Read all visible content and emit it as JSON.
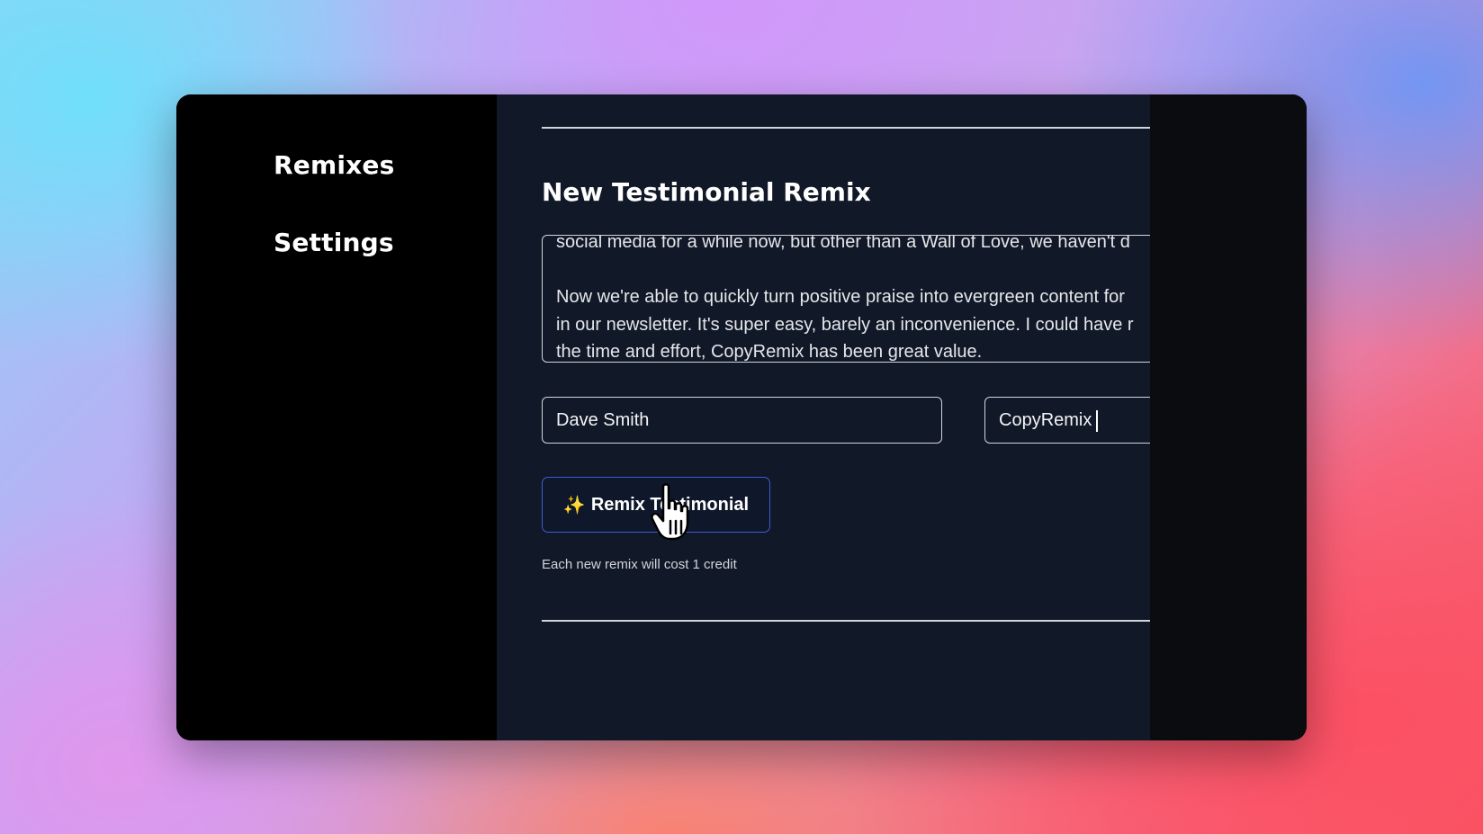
{
  "sidebar": {
    "items": [
      {
        "label": "Remixes"
      },
      {
        "label": "Settings"
      }
    ]
  },
  "form": {
    "title": "New Testimonial Remix",
    "testimonial_text": "social media for a while now, but other than a Wall of Love, we haven't d\n\nNow we're able to quickly turn positive praise into evergreen content for\nin our newsletter. It's super easy, barely an inconvenience. I could have r\nthe time and effort, CopyRemix has been great value.",
    "name_value": "Dave Smith",
    "company_value": "CopyRemix",
    "submit_label": "Remix Testimonial",
    "submit_icon": "sparkles-icon",
    "credit_note": "Each new remix will cost 1 credit"
  },
  "colors": {
    "sidebar_bg": "#000000",
    "main_bg": "#111827",
    "button_border": "#3b5bdb",
    "sparkle": "#facc15"
  }
}
